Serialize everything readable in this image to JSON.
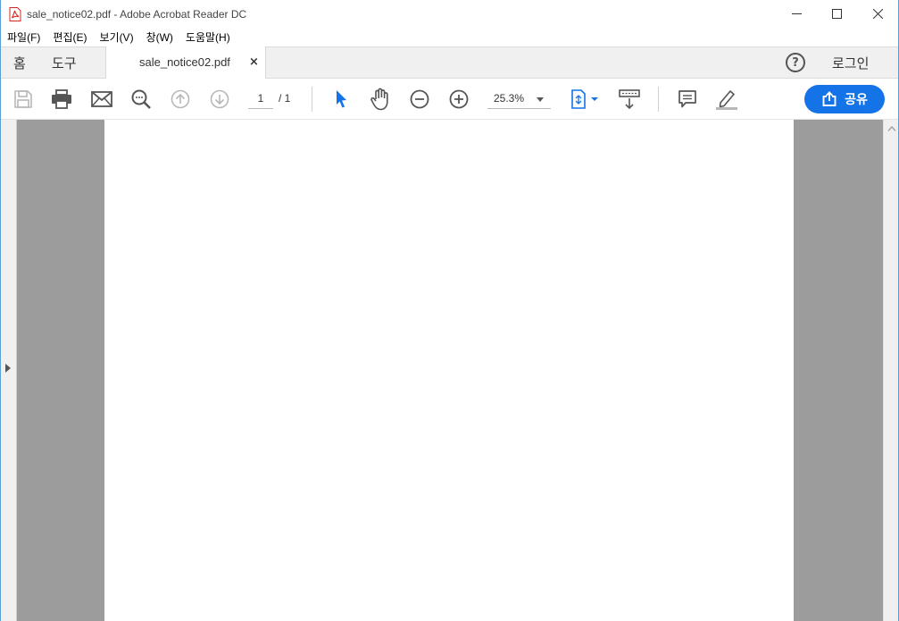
{
  "window": {
    "title": "sale_notice02.pdf - Adobe Acrobat Reader DC"
  },
  "menu": {
    "items": [
      "파일(F)",
      "편집(E)",
      "보기(V)",
      "창(W)",
      "도움말(H)"
    ]
  },
  "tabs": {
    "home": "홈",
    "tools": "도구",
    "document": "sale_notice02.pdf",
    "close": "×",
    "help": "?",
    "login": "로그인"
  },
  "toolbar": {
    "current_page": "1",
    "total_pages": "/ 1",
    "zoom": "25.3%",
    "share_label": "공유"
  },
  "colors": {
    "accent": "#1473e6",
    "pasteboard": "#9c9c9c",
    "icon_gray": "#555555",
    "icon_disabled": "#b8b8b8"
  },
  "icons": {
    "save": "save-icon",
    "print": "print-icon",
    "email": "email-icon",
    "search": "search-icon",
    "prev_page": "arrow-up-circle-icon",
    "next_page": "arrow-down-circle-icon",
    "select": "cursor-icon",
    "pan": "hand-icon",
    "zoom_out": "minus-circle-icon",
    "zoom_in": "plus-circle-icon",
    "fit": "fit-page-icon",
    "scroll_mode": "scroll-mode-icon",
    "comment": "comment-icon",
    "highlight": "highlight-pen-icon",
    "share": "share-icon"
  }
}
